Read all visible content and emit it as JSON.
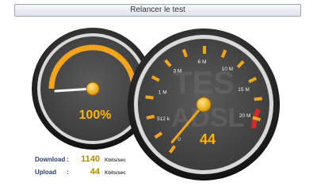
{
  "toolbar": {
    "retest_label": "Relancer le test"
  },
  "colors": {
    "needle": "#f2a51a",
    "dial_face": "#4a4a4a",
    "bezel": "#2a2a2a",
    "accent_text": "#ffb400",
    "red_zone": "#d42a2a"
  },
  "progress_gauge": {
    "percent_label": "100%",
    "progress": 1.0
  },
  "speed_gauge": {
    "value_label": "44",
    "watermark_line1": "TES",
    "watermark_line2": "ADSL",
    "ticks": [
      "0",
      "512 k",
      "1 M",
      "3 M",
      "6 M",
      "10 M",
      "15 M",
      "20 M"
    ],
    "value_fraction": 0.02
  },
  "stats": {
    "download_label": "Download",
    "download_value": "1140",
    "upload_label": "Upload",
    "upload_value": "44",
    "colon": ":",
    "unit": "Kbits/sec"
  }
}
